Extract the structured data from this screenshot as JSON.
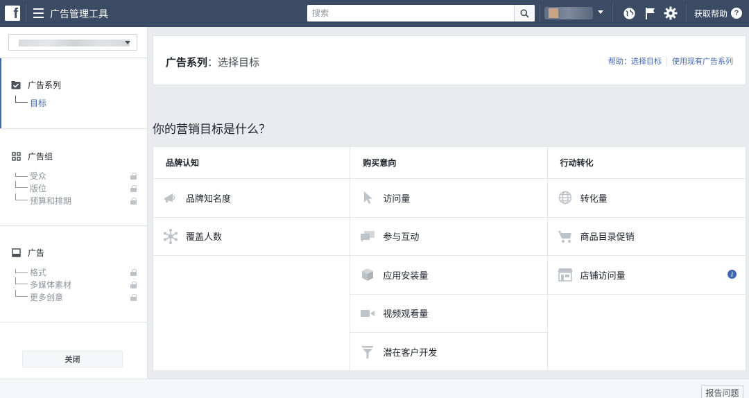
{
  "topbar": {
    "app_title": "广告管理工具",
    "search_placeholder": "搜索",
    "help_label": "获取帮助"
  },
  "sidebar": {
    "sections": [
      {
        "title": "广告系列",
        "items": [
          {
            "label": "目标",
            "active": true,
            "locked": false
          }
        ]
      },
      {
        "title": "广告组",
        "items": [
          {
            "label": "受众",
            "locked": true
          },
          {
            "label": "版位",
            "locked": true
          },
          {
            "label": "预算和排期",
            "locked": true
          }
        ]
      },
      {
        "title": "广告",
        "items": [
          {
            "label": "格式",
            "locked": true
          },
          {
            "label": "多媒体素材",
            "locked": true
          },
          {
            "label": "更多创意",
            "locked": true
          }
        ]
      }
    ],
    "close_label": "关闭"
  },
  "header": {
    "title_bold": "广告系列",
    "title_rest": "：选择目标",
    "help_link": "帮助：选择目标",
    "existing_link": "使用现有广告系列"
  },
  "question": "你的营销目标是什么？",
  "objectives": [
    {
      "heading": "品牌认知",
      "items": [
        {
          "label": "品牌知名度",
          "icon": "megaphone-icon"
        },
        {
          "label": "覆盖人数",
          "icon": "reach-burst-icon"
        }
      ]
    },
    {
      "heading": "购买意向",
      "items": [
        {
          "label": "访问量",
          "icon": "cursor-icon"
        },
        {
          "label": "参与互动",
          "icon": "chat-bubbles-icon"
        },
        {
          "label": "应用安装量",
          "icon": "box-icon"
        },
        {
          "label": "视频观看量",
          "icon": "video-camera-icon"
        },
        {
          "label": "潜在客户开发",
          "icon": "funnel-icon"
        }
      ]
    },
    {
      "heading": "行动转化",
      "items": [
        {
          "label": "转化量",
          "icon": "globe-icon"
        },
        {
          "label": "商品目录促销",
          "icon": "cart-icon"
        },
        {
          "label": "店铺访问量",
          "icon": "store-icon",
          "info": true
        }
      ]
    }
  ],
  "footer": {
    "report_label": "报告问题"
  },
  "colors": {
    "topbar": "#3b4b63",
    "accent": "#4267b2",
    "icon_gray": "#bec2c9"
  }
}
